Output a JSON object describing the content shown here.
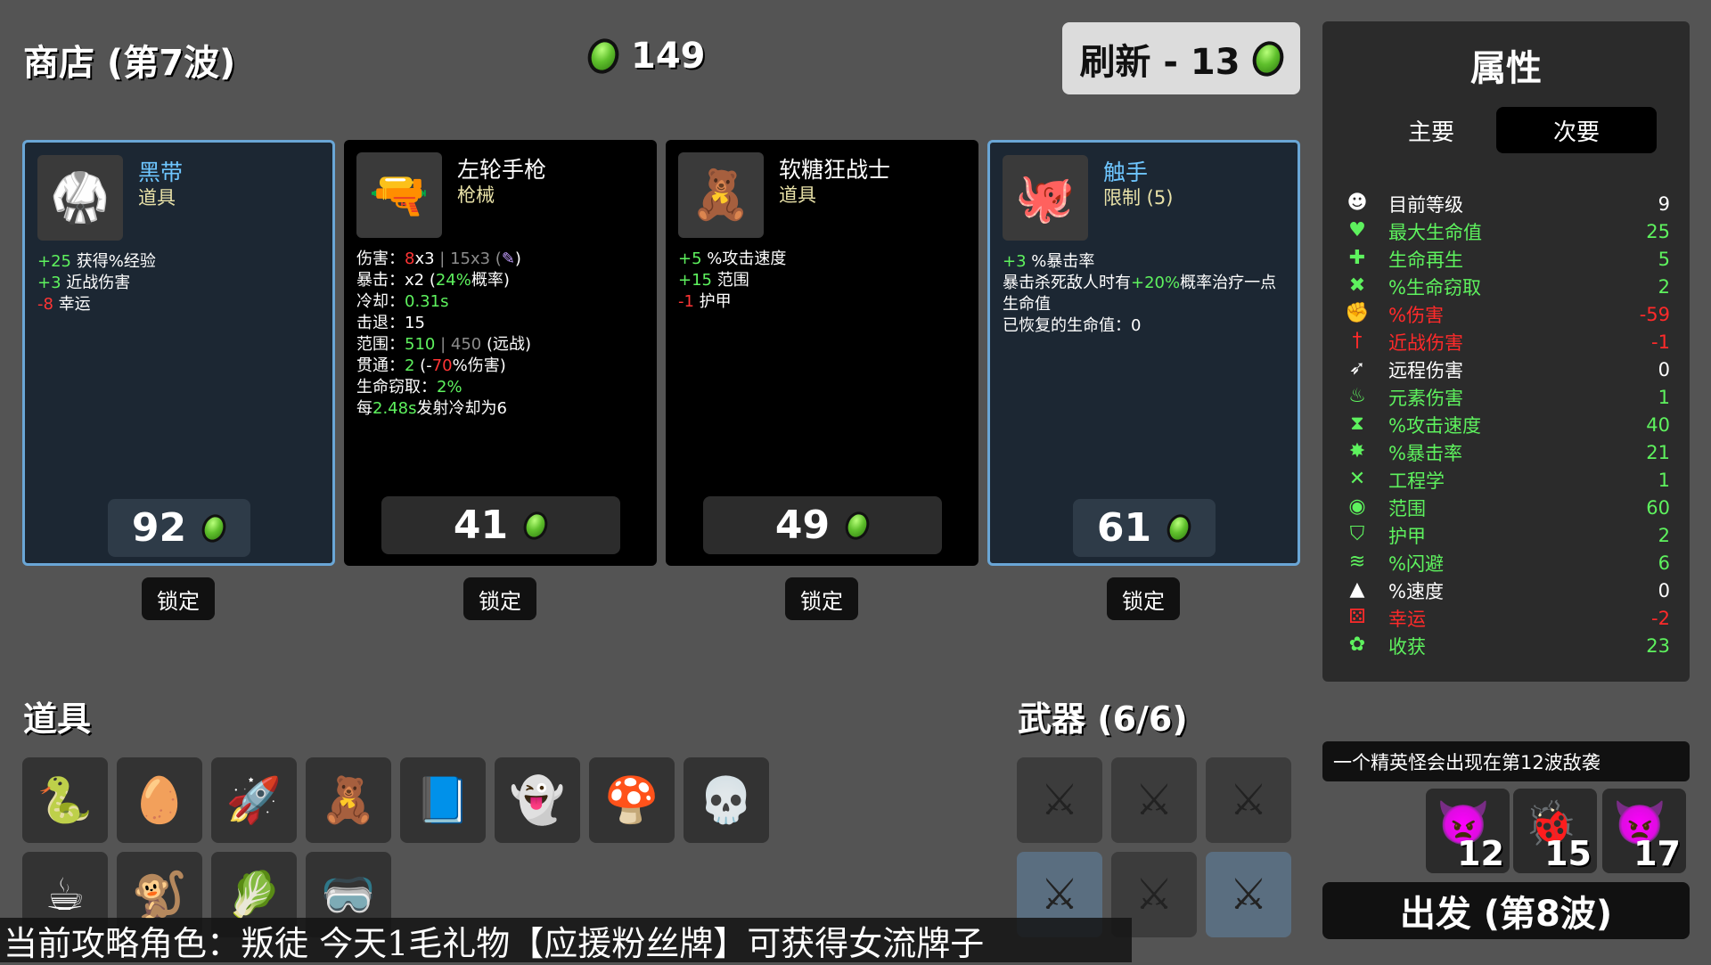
{
  "header": {
    "shop_title": "商店 (第7波)",
    "gold": "149",
    "reroll_label": "刷新 - 13"
  },
  "cards": [
    {
      "name": "黑带",
      "type": "道具",
      "price": "92",
      "icon": "black-belt-icon",
      "stats": [
        [
          [
            "+25",
            "g"
          ],
          [
            " 获得%经验",
            ""
          ]
        ],
        [
          [
            "+3",
            "g"
          ],
          [
            " 近战伤害",
            ""
          ]
        ],
        [
          [
            "-8",
            "r"
          ],
          [
            " 幸运",
            ""
          ]
        ]
      ]
    },
    {
      "name": "左轮手枪",
      "type": "枪械",
      "price": "41",
      "icon": "revolver-icon",
      "stats": [
        [
          [
            "伤害：",
            ""
          ],
          [
            "8",
            "r"
          ],
          [
            "x3",
            ""
          ],
          [
            " | 15x3 (",
            "gr"
          ],
          [
            "✎",
            "pur"
          ],
          [
            ")",
            ""
          ]
        ],
        [
          [
            "暴击：x2 (",
            ""
          ],
          [
            "24%",
            "g"
          ],
          [
            "概率)",
            ""
          ]
        ],
        [
          [
            "冷却：",
            ""
          ],
          [
            "0.31s",
            "g"
          ]
        ],
        [
          [
            "击退：15",
            ""
          ]
        ],
        [
          [
            "范围：",
            ""
          ],
          [
            "510",
            "g"
          ],
          [
            " | 450",
            "gr"
          ],
          [
            " (远战)",
            ""
          ]
        ],
        [
          [
            "贯通：",
            ""
          ],
          [
            "2",
            "g"
          ],
          [
            " (-",
            ""
          ],
          [
            "70",
            "r"
          ],
          [
            "%伤害)",
            ""
          ]
        ],
        [
          [
            "生命窃取：",
            ""
          ],
          [
            "2%",
            "g"
          ]
        ],
        [
          [
            "每",
            ""
          ],
          [
            "2.48s",
            "g"
          ],
          [
            "发射冷却为6",
            ""
          ]
        ]
      ]
    },
    {
      "name": "软糖狂战士",
      "type": "道具",
      "price": "49",
      "icon": "gummy-berserker-icon",
      "stats": [
        [
          [
            "+5",
            "g"
          ],
          [
            " %攻击速度",
            ""
          ]
        ],
        [
          [
            "+15",
            "g"
          ],
          [
            " 范围",
            ""
          ]
        ],
        [
          [
            "-1",
            "r"
          ],
          [
            " 护甲",
            ""
          ]
        ]
      ]
    },
    {
      "name": "触手",
      "type": "限制 (5)",
      "price": "61",
      "icon": "tentacle-icon",
      "stats": [
        [
          [
            "+3",
            "g"
          ],
          [
            " %暴击率",
            ""
          ]
        ],
        [
          [
            "暴击杀死敌人时有",
            ""
          ],
          [
            "+20%",
            "g"
          ],
          [
            "概率治疗一点生命值",
            ""
          ]
        ],
        [
          [
            "已恢复的生命值：0",
            ""
          ]
        ]
      ]
    }
  ],
  "lock_label": "锁定",
  "items_section": {
    "title": "道具",
    "slots": [
      "🐍",
      "🥚",
      "🚀",
      "🧸",
      "📘",
      "👻",
      "🍄",
      "💀",
      "☕",
      "🐒",
      "🥬",
      "🥽"
    ]
  },
  "weapons_section": {
    "title": "武器 (6/6)",
    "slots": [
      "⚔",
      "⚔",
      "⚔",
      "⚔",
      "⚔",
      "⚔"
    ]
  },
  "attributes": {
    "title": "属性",
    "tab_primary": "主要",
    "tab_secondary": "次要",
    "rows": [
      {
        "icon": "☻",
        "label": "目前等级",
        "value": "9",
        "color": "#ffffff"
      },
      {
        "icon": "♥",
        "label": "最大生命值",
        "value": "25",
        "color": "#5ef25e"
      },
      {
        "icon": "✚",
        "label": "生命再生",
        "value": "5",
        "color": "#5ef25e"
      },
      {
        "icon": "✖",
        "label": "%生命窃取",
        "value": "2",
        "color": "#5ef25e"
      },
      {
        "icon": "✊",
        "label": "%伤害",
        "value": "-59",
        "color": "#ff2a2a"
      },
      {
        "icon": "†",
        "label": "近战伤害",
        "value": "-1",
        "color": "#ff2a2a"
      },
      {
        "icon": "➶",
        "label": "远程伤害",
        "value": "0",
        "color": "#ffffff"
      },
      {
        "icon": "♨",
        "label": "元素伤害",
        "value": "1",
        "color": "#5ef25e"
      },
      {
        "icon": "⧗",
        "label": "%攻击速度",
        "value": "40",
        "color": "#5ef25e"
      },
      {
        "icon": "✸",
        "label": "%暴击率",
        "value": "21",
        "color": "#5ef25e"
      },
      {
        "icon": "✕",
        "label": "工程学",
        "value": "1",
        "color": "#5ef25e"
      },
      {
        "icon": "◉",
        "label": "范围",
        "value": "60",
        "color": "#5ef25e"
      },
      {
        "icon": "⛉",
        "label": "护甲",
        "value": "2",
        "color": "#5ef25e"
      },
      {
        "icon": "≋",
        "label": "%闪避",
        "value": "6",
        "color": "#5ef25e"
      },
      {
        "icon": "▲",
        "label": "%速度",
        "value": "0",
        "color": "#ffffff"
      },
      {
        "icon": "⚄",
        "label": "幸运",
        "value": "-2",
        "color": "#ff2a2a"
      },
      {
        "icon": "✿",
        "label": "收获",
        "value": "23",
        "color": "#5ef25e"
      }
    ]
  },
  "notice": "一个精英怪会出现在第12波敌袭",
  "enemies": [
    {
      "wave": "12"
    },
    {
      "wave": "15"
    },
    {
      "wave": "17"
    }
  ],
  "go_label": "出发 (第8波)",
  "overlay_text": "当前攻略角色：叛徒 今天1毛礼物【应援粉丝牌】可获得女流牌子"
}
